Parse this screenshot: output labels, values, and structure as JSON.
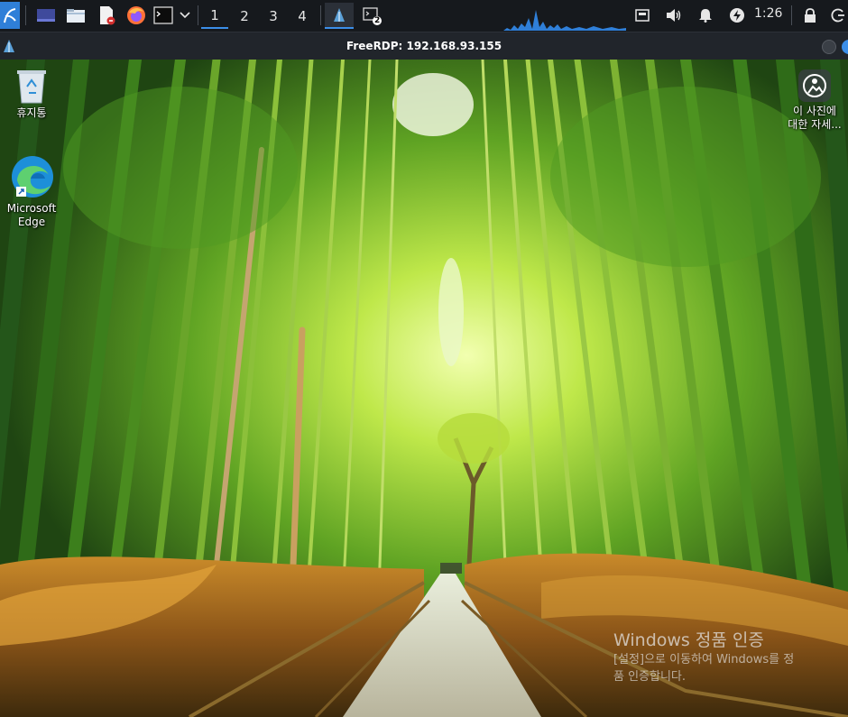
{
  "taskbar": {
    "workspaces": [
      "1",
      "2",
      "3",
      "4"
    ],
    "active_workspace": "1",
    "terminal_badge": "2",
    "clock": "1:26",
    "icons": [
      "kde-menu-icon",
      "desktop-icon",
      "file-manager-icon",
      "text-editor-icon",
      "firefox-icon",
      "terminal-icon",
      "chevron-down-icon",
      "freerdp-icon",
      "terminal-window-icon",
      "screen-icon",
      "volume-icon",
      "notification-bell-icon",
      "power-status-icon",
      "lock-icon",
      "logout-icon"
    ],
    "accent_color": "#3b8ee8"
  },
  "window": {
    "title": "FreeRDP: 192.168.93.155"
  },
  "desktop": {
    "recycle_bin_label": "휴지통",
    "edge_label_line1": "Microsoft",
    "edge_label_line2": "Edge",
    "photo_info_line1": "이 사진에",
    "photo_info_line2": "대한 자세...",
    "activation_title": "Windows 정품 인증",
    "activation_line1": "[설정]으로 이동하여 Windows를 정",
    "activation_line2": "품 인증합니다."
  }
}
